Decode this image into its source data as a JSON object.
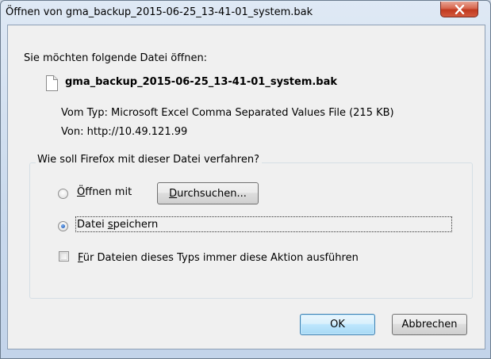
{
  "window": {
    "title": "Öffnen von gma_backup_2015-06-25_13-41-01_system.bak"
  },
  "dialog": {
    "prompt": "Sie möchten folgende Datei öffnen:",
    "file_name": "gma_backup_2015-06-25_13-41-01_system.bak",
    "type_label": "Vom Typ:",
    "type_value": "Microsoft Excel Comma Separated Values File (215 KB)",
    "from_label": "Von:",
    "from_value": "http://10.49.121.99",
    "question": "Wie soll Firefox mit dieser Datei verfahren?",
    "options": {
      "open_with": {
        "label_access": "Ö",
        "label_rest": "ffnen mit",
        "selected": false
      },
      "save_file": {
        "label_pre": "Datei ",
        "label_access": "s",
        "label_rest": "peichern",
        "selected": true
      }
    },
    "browse_button": {
      "label_access": "D",
      "label_rest": "urchsuchen..."
    },
    "always_checkbox": {
      "label_access": "F",
      "label_rest": "ür Dateien dieses Typs immer diese Aktion ausführen",
      "checked": false
    },
    "ok_button": "OK",
    "cancel_button": "Abbrechen"
  },
  "icons": {
    "close": "close-icon",
    "file": "file-icon"
  },
  "colors": {
    "close_button": "#c0391f",
    "default_button_border": "#3c7fb1",
    "radio_selected": "#2e69c2"
  }
}
